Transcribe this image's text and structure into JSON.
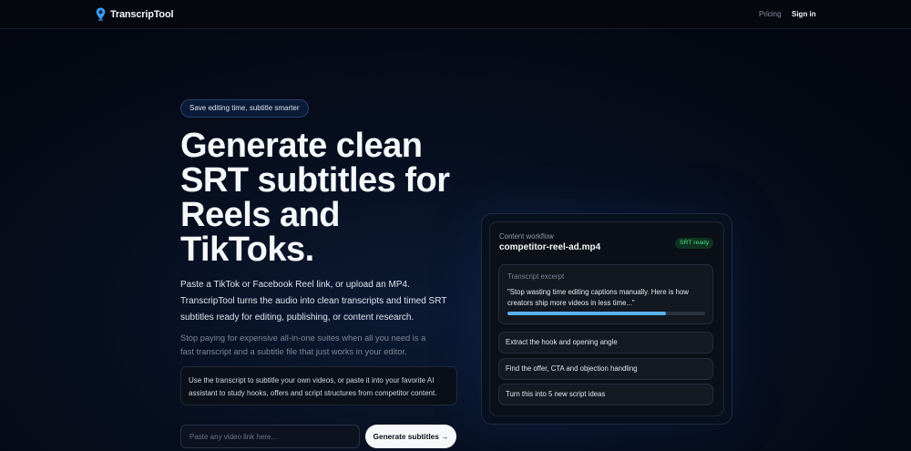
{
  "brand": {
    "name": "TranscripTool",
    "icon": "pin-drop-icon",
    "accent": "#3b9bf0"
  },
  "nav": {
    "pricing": "Pricing",
    "sign_in": "Sign in"
  },
  "hero": {
    "badge": "Save editing time, subtitle smarter",
    "headline": "Generate clean SRT subtitles for Reels and TikToks.",
    "lead": "Paste a TikTok or Facebook Reel link, or upload an MP4. TranscripTool turns the audio into clean transcripts and timed SRT subtitles ready for editing, publishing, or content research.",
    "sub": "Stop paying for expensive all-in-one suites when all you need is a fast transcript and a subtitle file that just works in your editor.",
    "tip": "Use the transcript to subtitle your own videos, or paste it into your favorite AI assistant to study hooks, offers and script structures from competitor content.",
    "input_placeholder": "Paste any video link here...",
    "input_value": "",
    "cta_label": "Generate subtitles →"
  },
  "workflow": {
    "label": "Content workflow",
    "filename": "competitor-reel-ad.mp4",
    "status": "SRT ready",
    "status_color": "#4ade80",
    "excerpt_label": "Transcript excerpt",
    "excerpt_quote": "\"Stop wasting time editing captions manually. Here is how creators ship more videos in less time...\"",
    "progress": 0.8,
    "progress_color": "#5ab0f0",
    "actions": [
      {
        "label": "Extract the hook and opening angle"
      },
      {
        "label": "Find the offer, CTA and objection handling"
      },
      {
        "label": "Turn this into 5 new script ideas"
      }
    ]
  }
}
